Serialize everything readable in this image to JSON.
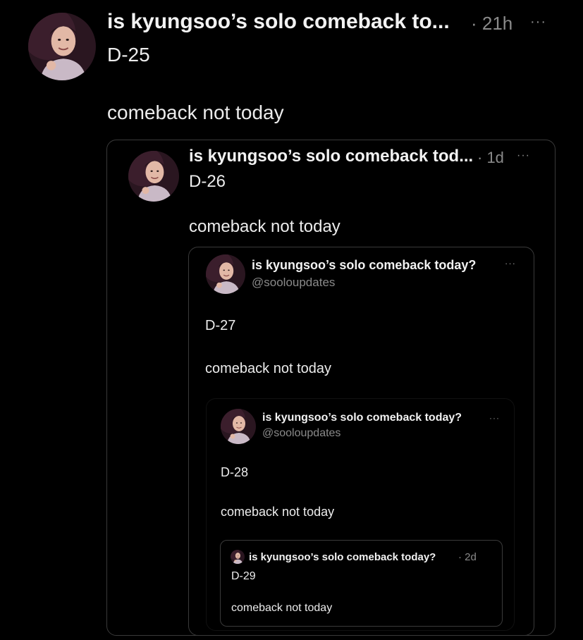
{
  "post": {
    "author": "is kyungsoo’s solo comeback to...",
    "time": "· 21h",
    "more": "···",
    "line1": "D-25",
    "line2": "comeback not today"
  },
  "quote1": {
    "author": "is kyungsoo’s solo comeback tod...",
    "time": "· 1d",
    "more": "···",
    "line1": "D-26",
    "line2": "comeback not today"
  },
  "quote2": {
    "author": "is kyungsoo’s solo comeback today?",
    "handle": "@sooloupdates",
    "more": "···",
    "line1": "D-27",
    "line2": "comeback not today"
  },
  "quote3": {
    "author": "is kyungsoo’s solo comeback today?",
    "handle": "@sooloupdates",
    "more": "···",
    "line1": "D-28",
    "line2": "comeback not today"
  },
  "quote4": {
    "author": "is kyungsoo’s solo comeback today?",
    "time": "· 2d",
    "line1": "D-29",
    "line2": "comeback not today"
  },
  "icons": {
    "avatar": "profile-avatar",
    "more": "more-options-icon"
  }
}
